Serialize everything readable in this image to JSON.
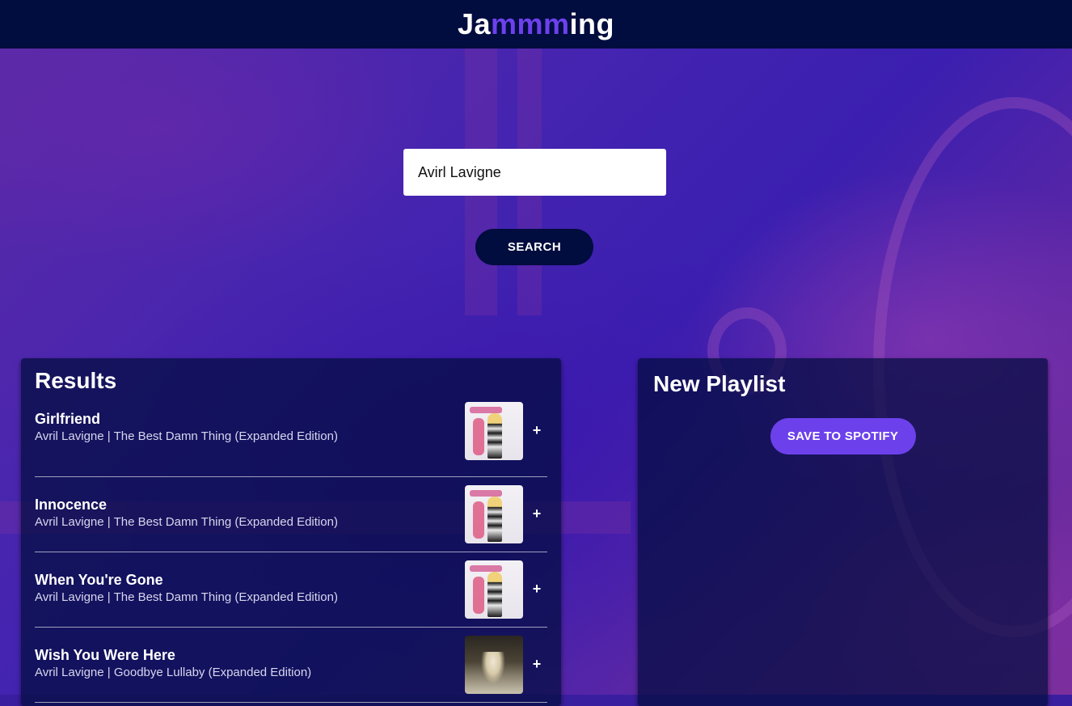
{
  "header": {
    "logo_prefix": "Ja",
    "logo_accent": "mmm",
    "logo_suffix": "ing",
    "accent_color": "#6c41ec",
    "bar_color": "#010c3f"
  },
  "search": {
    "value": "Avirl Lavigne",
    "button_label": "SEARCH"
  },
  "results": {
    "title": "Results",
    "tracks": [
      {
        "name": "Girlfriend",
        "meta": "Avril Lavigne | The Best Damn Thing (Expanded Edition)",
        "art": "album-art-best-damn-thing",
        "action": "+"
      },
      {
        "name": "Innocence",
        "meta": "Avril Lavigne | The Best Damn Thing (Expanded Edition)",
        "art": "album-art-best-damn-thing",
        "action": "+"
      },
      {
        "name": "When You're Gone",
        "meta": "Avril Lavigne | The Best Damn Thing (Expanded Edition)",
        "art": "album-art-best-damn-thing",
        "action": "+"
      },
      {
        "name": "Wish You Were Here",
        "meta": "Avril Lavigne | Goodbye Lullaby (Expanded Edition)",
        "art": "album-art-goodbye-lullaby",
        "action": "+"
      }
    ]
  },
  "playlist": {
    "title": "New Playlist",
    "save_label": "SAVE TO SPOTIFY"
  }
}
